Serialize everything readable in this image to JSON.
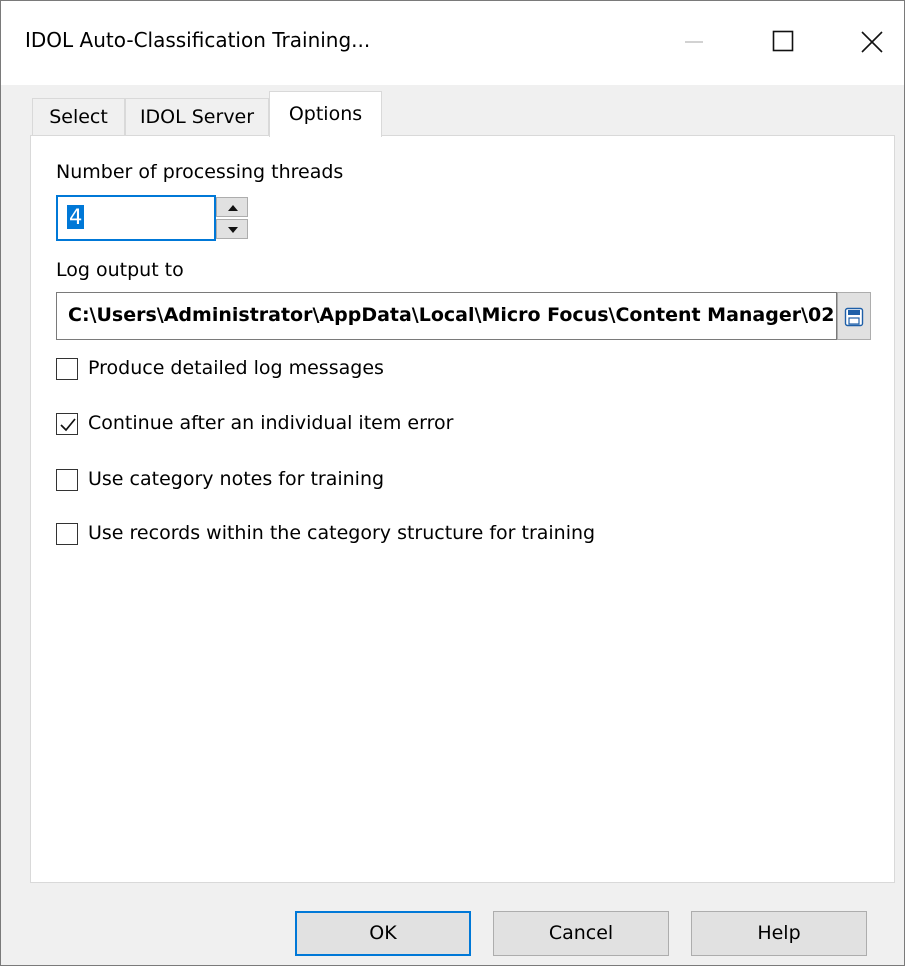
{
  "window": {
    "title": "IDOL Auto-Classification Training..."
  },
  "tabs": [
    {
      "label": "Select",
      "active": false
    },
    {
      "label": "IDOL Server",
      "active": false
    },
    {
      "label": "Options",
      "active": true
    }
  ],
  "options": {
    "threads_label": "Number of processing threads",
    "threads_value": "4",
    "log_label": "Log output to",
    "log_path": "C:\\Users\\Administrator\\AppData\\Local\\Micro Focus\\Content Manager\\02",
    "checkboxes": [
      {
        "label": "Produce detailed log messages",
        "checked": false
      },
      {
        "label": "Continue after an individual item error",
        "checked": true
      },
      {
        "label": "Use category notes for training",
        "checked": false
      },
      {
        "label": "Use records within the category structure for training",
        "checked": false
      }
    ]
  },
  "buttons": {
    "ok": "OK",
    "cancel": "Cancel",
    "help": "Help"
  },
  "colors": {
    "accent": "#0078d7",
    "button_face": "#e1e1e1",
    "dialog_background": "#f0f0f0"
  },
  "icons": {
    "minimize": "minimize-icon",
    "maximize": "maximize-icon",
    "close": "close-icon",
    "spin_up": "arrow-up-icon",
    "spin_down": "arrow-down-icon",
    "browse": "floppy-disk-icon"
  }
}
